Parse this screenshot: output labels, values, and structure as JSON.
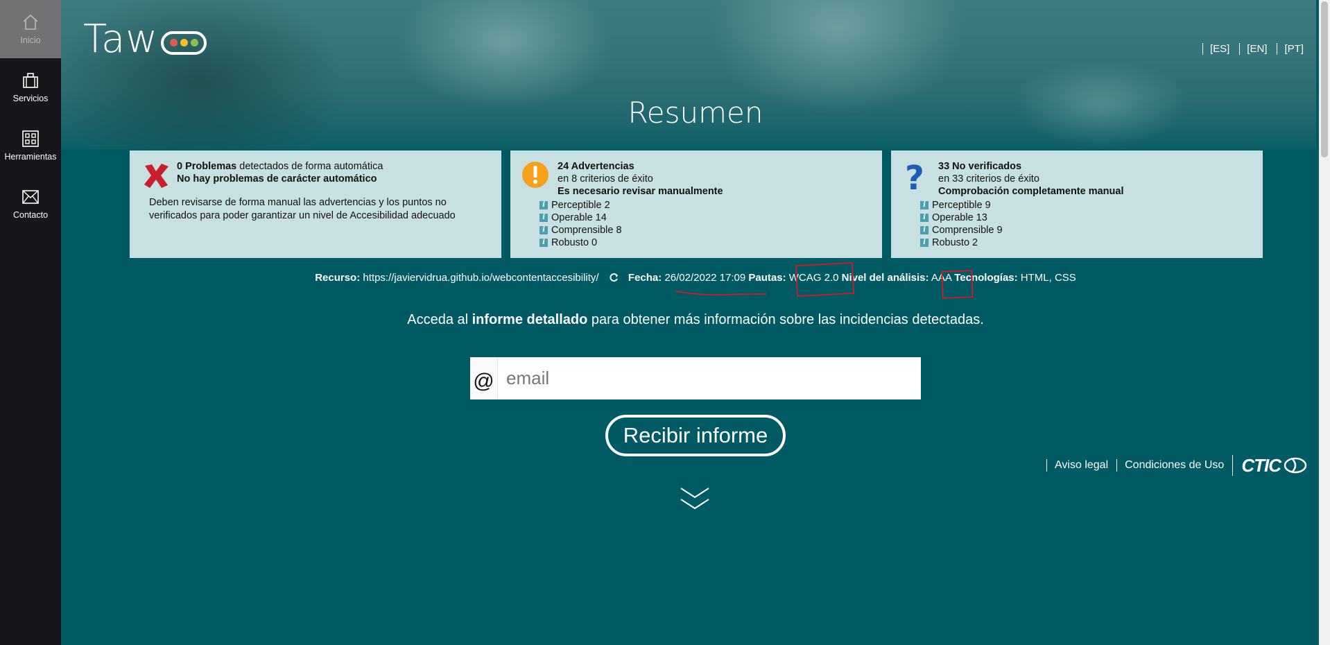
{
  "sidebar": {
    "items": [
      {
        "label": "Inicio",
        "icon": "home-icon"
      },
      {
        "label": "Servicios",
        "icon": "briefcase-icon"
      },
      {
        "label": "Herramientas",
        "icon": "grid-icon"
      },
      {
        "label": "Contacto",
        "icon": "mail-icon"
      }
    ]
  },
  "header": {
    "logo_text": "Taw",
    "languages": [
      "[ES]",
      "[EN]",
      "[PT]"
    ],
    "title": "Resumen"
  },
  "cards": {
    "problems": {
      "count_label": "0 Problemas",
      "line1_rest": " detectados de forma automática",
      "line2": "No hay problemas de carácter automático",
      "description": "Deben revisarse de forma manual las advertencias y los puntos no verificados para poder garantizar un nivel de Accesibilidad adecuado"
    },
    "warnings": {
      "title": "24 Advertencias",
      "line2": "en 8 criterios de éxito",
      "line3": "Es necesario revisar manualmente",
      "items": [
        "Perceptible 2",
        "Operable 14",
        "Comprensible 8",
        "Robusto 0"
      ]
    },
    "unverified": {
      "title": "33 No verificados",
      "line2": "en 33 criterios de éxito",
      "line3": "Comprobación completamente manual",
      "items": [
        "Perceptible 9",
        "Operable 13",
        "Comprensible 9",
        "Robusto 2"
      ]
    }
  },
  "meta": {
    "resource_label": "Recurso:",
    "resource_value": "https://javiervidrua.github.io/webcontentaccesibility/",
    "date_label": "Fecha:",
    "date_value": "26/02/2022 17:09",
    "guidelines_label": "Pautas:",
    "guidelines_value": "WCAG 2.0",
    "level_label": "Nivel del análisis:",
    "level_value": "AAA",
    "tech_label": "Tecnologías:",
    "tech_value": "HTML, CSS"
  },
  "cta": {
    "prefix": "Acceda al ",
    "bold": "informe detallado",
    "suffix": " para obtener más información sobre las incidencias detectadas."
  },
  "email": {
    "at_symbol": "@",
    "placeholder": "email",
    "value": ""
  },
  "submit_label": "Recibir informe",
  "footer": {
    "links": [
      "Aviso legal",
      "Condiciones de Uso"
    ],
    "brand": "CTIC"
  },
  "colors": {
    "sidebar_bg": "#16161b",
    "main_bg": "#005a63",
    "card_bg": "#c9e0e2",
    "annotation": "#c0202a",
    "dot_red": "#e05a4f",
    "dot_yellow": "#f2c12e",
    "dot_green": "#8cc152"
  }
}
